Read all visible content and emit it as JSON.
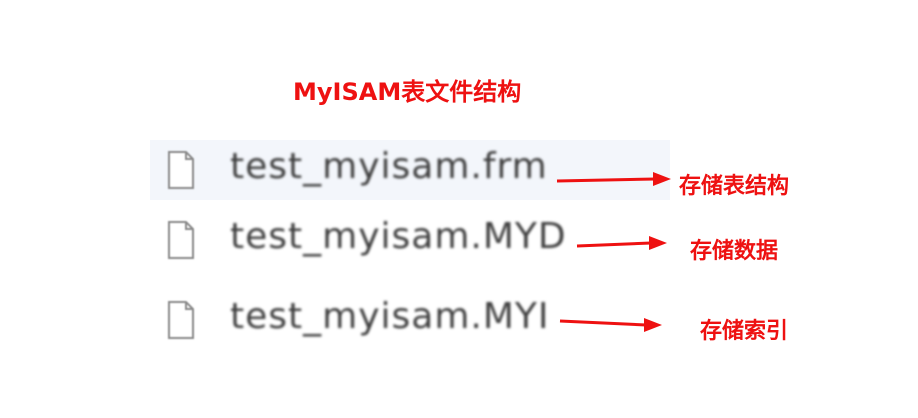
{
  "title": "MyISAM表文件结构",
  "accent_color": "#ee1111",
  "files": [
    {
      "name": "test_myisam.frm",
      "icon": "file-icon",
      "label": "存储表结构"
    },
    {
      "name": "test_myisam.MYD",
      "icon": "file-icon",
      "label": "存储数据"
    },
    {
      "name": "test_myisam.MYI",
      "icon": "file-icon",
      "label": "存储索引"
    }
  ]
}
